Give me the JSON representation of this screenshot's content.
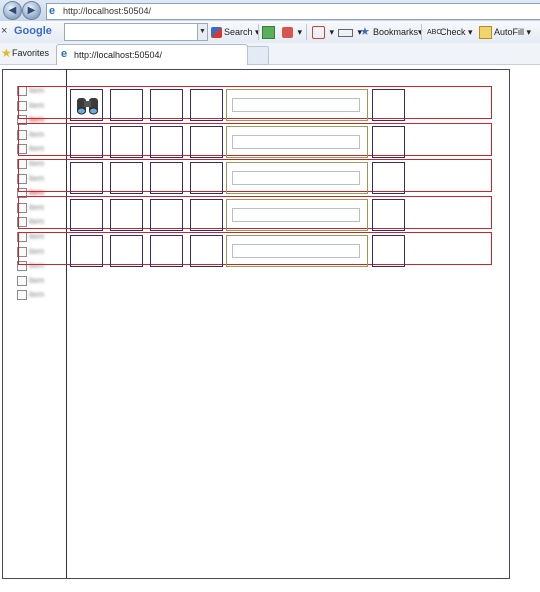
{
  "browser": {
    "address_url": "http://localhost:50504/",
    "toolbar": {
      "close": "×",
      "google_logo": "Google",
      "search_value": "",
      "search_label": "Search",
      "bookmarks_label": "Bookmarks",
      "check_label": "Check",
      "autofill_label": "AutoFill"
    },
    "favorites_label": "Favorites",
    "tab_title": "http://localhost:50504/",
    "icons": {
      "back": "back-arrow-icon",
      "forward": "forward-arrow-icon",
      "ie": "ie-logo-icon",
      "star": "star-icon"
    }
  },
  "checkbox_list": {
    "items": [
      {
        "label": "item",
        "style": "normal"
      },
      {
        "label": "item",
        "style": "normal"
      },
      {
        "label": "item",
        "style": "red"
      },
      {
        "label": "item",
        "style": "normal"
      },
      {
        "label": "item",
        "style": "normal"
      },
      {
        "label": "item",
        "style": "normal"
      },
      {
        "label": "item",
        "style": "normal"
      },
      {
        "label": "item",
        "style": "red"
      },
      {
        "label": "item",
        "style": "normal"
      },
      {
        "label": "item",
        "style": "normal"
      },
      {
        "label": "item",
        "style": "normal"
      },
      {
        "label": "item",
        "style": "normal"
      },
      {
        "label": "item",
        "style": "normal"
      },
      {
        "label": "item",
        "style": "normal"
      },
      {
        "label": "item",
        "style": "normal"
      }
    ]
  },
  "grid": {
    "rows": [
      {
        "has_icon": true,
        "input_value": ""
      },
      {
        "has_icon": false,
        "input_value": ""
      },
      {
        "has_icon": false,
        "input_value": ""
      },
      {
        "has_icon": false,
        "input_value": ""
      },
      {
        "has_icon": false,
        "input_value": ""
      }
    ]
  },
  "colors": {
    "row_border": "#c9262c",
    "cell_border": "#3a2a6a",
    "input_cell_border": "#9b9a55"
  }
}
